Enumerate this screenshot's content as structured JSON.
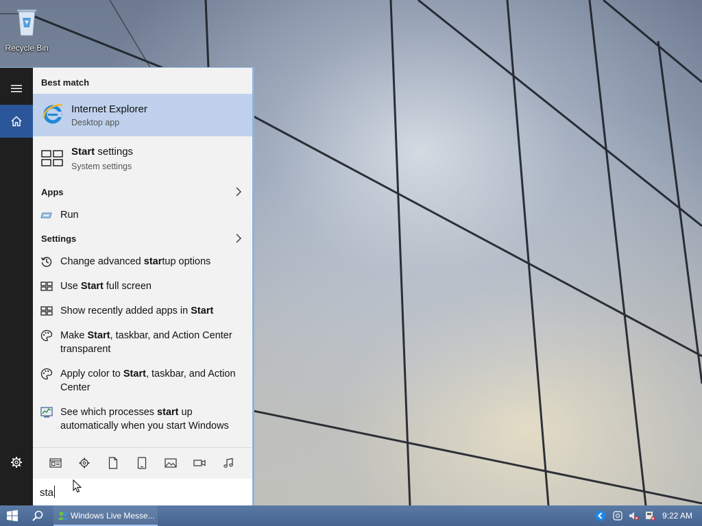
{
  "desktop": {
    "recycle_bin_label": "Recycle Bin"
  },
  "start_menu": {
    "best_match_header": "Best match",
    "best_match": {
      "title": "Internet Explorer",
      "subtitle": "Desktop app",
      "icon": "internet-explorer-icon"
    },
    "second_match": {
      "title_bold": "Start",
      "title_rest": " settings",
      "subtitle": "System settings",
      "icon": "start-settings-icon"
    },
    "apps_header": "Apps",
    "apps": [
      {
        "label": "Run",
        "icon": "run-icon"
      }
    ],
    "settings_header": "Settings",
    "settings": [
      {
        "pre": "Change advanced ",
        "bold": "star",
        "post": "tup options",
        "icon": "history-icon"
      },
      {
        "pre": "Use ",
        "bold": "Start",
        "post": " full screen",
        "icon": "start-layout-icon"
      },
      {
        "pre": "Show recently added apps in ",
        "bold": "Start",
        "post": "",
        "icon": "start-layout-icon"
      },
      {
        "pre": "Make ",
        "bold": "Start",
        "post": ", taskbar, and Action Center transparent",
        "icon": "palette-icon"
      },
      {
        "pre": "Apply color to ",
        "bold": "Start",
        "post": ", taskbar, and Action Center",
        "icon": "palette-icon"
      },
      {
        "pre": "See which processes ",
        "bold": "start",
        "post": " up automatically when you start Windows",
        "icon": "task-manager-icon"
      }
    ],
    "filters": [
      "documents-icon",
      "settings-icon",
      "file-icon",
      "tablet-icon",
      "photo-icon",
      "video-icon",
      "music-icon"
    ],
    "search_value": "sta"
  },
  "taskbar": {
    "running_app_label": "Windows Live Messe...",
    "clock": "9:22 AM"
  },
  "colors": {
    "accent": "#2b579a",
    "best_match_highlight": "#bfd1ec",
    "taskbar": "#4f6f9c",
    "rail": "#1f1f1f"
  }
}
